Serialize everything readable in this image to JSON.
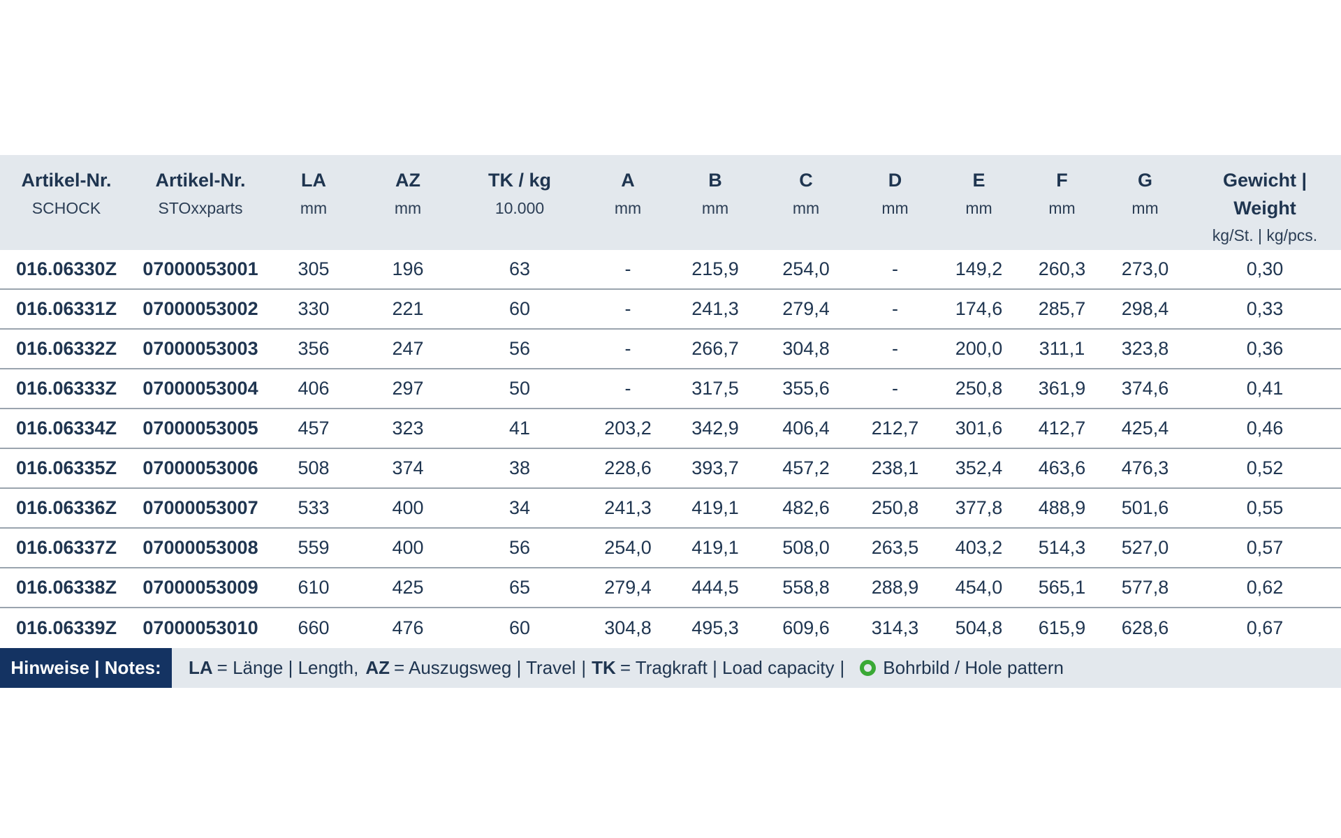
{
  "columns": [
    {
      "title": "Artikel-Nr.",
      "sub": "SCHOCK",
      "sub2": ""
    },
    {
      "title": "Artikel-Nr.",
      "sub": "STOxxparts",
      "sub2": ""
    },
    {
      "title": "LA",
      "sub": "mm",
      "sub2": ""
    },
    {
      "title": "AZ",
      "sub": "mm",
      "sub2": ""
    },
    {
      "title": "TK / kg",
      "sub": "10.000",
      "sub2": ""
    },
    {
      "title": "A",
      "sub": "mm",
      "sub2": ""
    },
    {
      "title": "B",
      "sub": "mm",
      "sub2": ""
    },
    {
      "title": "C",
      "sub": "mm",
      "sub2": ""
    },
    {
      "title": "D",
      "sub": "mm",
      "sub2": ""
    },
    {
      "title": "E",
      "sub": "mm",
      "sub2": ""
    },
    {
      "title": "F",
      "sub": "mm",
      "sub2": ""
    },
    {
      "title": "G",
      "sub": "mm",
      "sub2": ""
    },
    {
      "title": "Gewicht |",
      "sub": "Weight",
      "sub2": "kg/St. | kg/pcs."
    }
  ],
  "rows": [
    [
      "016.06330Z",
      "07000053001",
      "305",
      "196",
      "63",
      "-",
      "215,9",
      "254,0",
      "-",
      "149,2",
      "260,3",
      "273,0",
      "0,30"
    ],
    [
      "016.06331Z",
      "07000053002",
      "330",
      "221",
      "60",
      "-",
      "241,3",
      "279,4",
      "-",
      "174,6",
      "285,7",
      "298,4",
      "0,33"
    ],
    [
      "016.06332Z",
      "07000053003",
      "356",
      "247",
      "56",
      "-",
      "266,7",
      "304,8",
      "-",
      "200,0",
      "311,1",
      "323,8",
      "0,36"
    ],
    [
      "016.06333Z",
      "07000053004",
      "406",
      "297",
      "50",
      "-",
      "317,5",
      "355,6",
      "-",
      "250,8",
      "361,9",
      "374,6",
      "0,41"
    ],
    [
      "016.06334Z",
      "07000053005",
      "457",
      "323",
      "41",
      "203,2",
      "342,9",
      "406,4",
      "212,7",
      "301,6",
      "412,7",
      "425,4",
      "0,46"
    ],
    [
      "016.06335Z",
      "07000053006",
      "508",
      "374",
      "38",
      "228,6",
      "393,7",
      "457,2",
      "238,1",
      "352,4",
      "463,6",
      "476,3",
      "0,52"
    ],
    [
      "016.06336Z",
      "07000053007",
      "533",
      "400",
      "34",
      "241,3",
      "419,1",
      "482,6",
      "250,8",
      "377,8",
      "488,9",
      "501,6",
      "0,55"
    ],
    [
      "016.06337Z",
      "07000053008",
      "559",
      "400",
      "56",
      "254,0",
      "419,1",
      "508,0",
      "263,5",
      "403,2",
      "514,3",
      "527,0",
      "0,57"
    ],
    [
      "016.06338Z",
      "07000053009",
      "610",
      "425",
      "65",
      "279,4",
      "444,5",
      "558,8",
      "288,9",
      "454,0",
      "565,1",
      "577,8",
      "0,62"
    ],
    [
      "016.06339Z",
      "07000053010",
      "660",
      "476",
      "60",
      "304,8",
      "495,3",
      "609,6",
      "314,3",
      "504,8",
      "615,9",
      "628,6",
      "0,67"
    ]
  ],
  "notes": {
    "label": "Hinweise | Notes:",
    "la_key": "LA",
    "la_text": "= Länge | Length,",
    "az_key": "AZ",
    "az_text": "= Auszugsweg | Travel",
    "sep": "|",
    "tk_key": "TK",
    "tk_text": "= Tragkraft | Load capacity",
    "sep2": "|",
    "hole_text": "Bohrbild / Hole pattern",
    "hole_icon": "green-ring-icon",
    "hole_color": "#3aa935"
  },
  "colors": {
    "header_bg": "#e3e8ed",
    "notes_label_bg": "#143362",
    "text": "#1f3550"
  }
}
